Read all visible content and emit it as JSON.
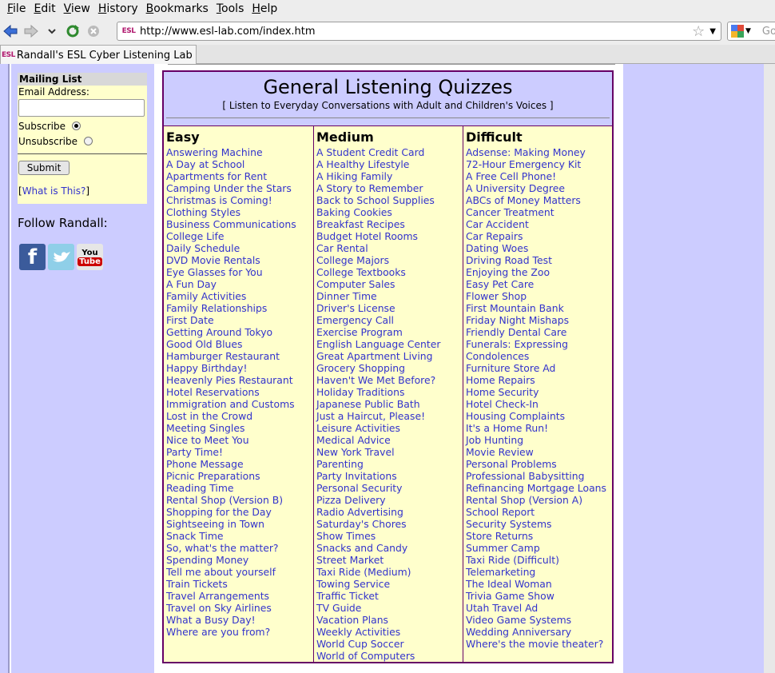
{
  "browser": {
    "menu": [
      "File",
      "Edit",
      "View",
      "History",
      "Bookmarks",
      "Tools",
      "Help"
    ],
    "url": "http://www.esl-lab.com/index.htm",
    "favicon_text": "ESL",
    "search_placeholder": "Go",
    "tab_title": "Randall's ESL Cyber Listening Lab ..."
  },
  "sidebar": {
    "mailing_title": "Mailing List",
    "email_label": "Email Address:",
    "email_value": "",
    "subscribe_label": "Subscribe",
    "unsubscribe_label": "Unsubscribe",
    "selected": "subscribe",
    "submit_label": "Submit",
    "whatis_prefix": "[",
    "whatis_link": "What is This?",
    "whatis_suffix": "]",
    "follow_label": "Follow Randall:",
    "social": [
      "facebook-icon",
      "twitter-icon",
      "youtube-icon"
    ],
    "youtube_text_top": "You",
    "youtube_text_bottom": "Tube"
  },
  "main": {
    "title": "General Listening Quizzes",
    "subtitle": "[ Listen to Everyday Conversations with Adult and Children's Voices ]",
    "columns": [
      {
        "title": "Easy",
        "items": [
          "Answering Machine",
          "A Day at School",
          "Apartments for Rent",
          "Camping Under the Stars",
          "Christmas is Coming!",
          "Clothing Styles",
          "Business Communications",
          "College Life",
          "Daily Schedule",
          "DVD Movie Rentals",
          "Eye Glasses for You",
          "A Fun Day",
          "Family Activities",
          "Family Relationships",
          "First Date",
          "Getting Around Tokyo",
          "Good Old Blues",
          "Hamburger Restaurant",
          "Happy Birthday!",
          "Heavenly Pies Restaurant",
          "Hotel Reservations",
          "Immigration and Customs",
          "Lost in the Crowd",
          "Meeting Singles",
          "Nice to Meet You",
          "Party Time!",
          "Phone Message",
          "Picnic Preparations",
          "Reading Time",
          "Rental Shop (Version B)",
          "Shopping for the Day",
          "Sightseeing in Town",
          "Snack Time",
          "So, what's the matter?",
          "Spending Money",
          "Tell me about yourself",
          "Train Tickets",
          "Travel Arrangements",
          "Travel on Sky Airlines",
          "What a Busy Day!",
          "Where are you from?"
        ]
      },
      {
        "title": "Medium",
        "items": [
          "A Student Credit Card",
          "A Healthy Lifestyle",
          "A Hiking Family",
          "A Story to Remember",
          "Back to School Supplies",
          "Baking Cookies",
          "Breakfast Recipes",
          "Budget Hotel Rooms",
          "Car Rental",
          "College Majors",
          "College Textbooks",
          "Computer Sales",
          "Dinner Time",
          "Driver's License",
          "Emergency Call",
          "Exercise Program",
          "English Language Center",
          "Great Apartment Living",
          "Grocery Shopping",
          "Haven't We Met Before?",
          "Holiday Traditions",
          "Japanese Public Bath",
          "Just a Haircut, Please!",
          "Leisure Activities",
          "Medical Advice",
          "New York Travel",
          "Parenting",
          "Party Invitations",
          "Personal Security",
          "Pizza Delivery",
          "Radio Advertising",
          "Saturday's Chores",
          "Show Times",
          "Snacks and Candy",
          "Street Market",
          "Taxi Ride (Medium)",
          "Towing Service",
          "Traffic Ticket",
          "TV Guide",
          "Vacation Plans",
          "Weekly Activities",
          "World Cup Soccer",
          "World of Computers"
        ]
      },
      {
        "title": "Difficult",
        "items": [
          "Adsense: Making Money",
          "72-Hour Emergency Kit",
          "A Free Cell Phone!",
          "A University Degree",
          "ABCs of Money Matters",
          "Cancer Treatment",
          "Car Accident",
          "Car Repairs",
          "Dating Woes",
          "Driving Road Test",
          "Enjoying the Zoo",
          "Easy Pet Care",
          "Flower Shop",
          "First Mountain Bank",
          "Friday Night Mishaps",
          "Friendly Dental Care",
          "Funerals: Expressing",
          "Condolences",
          "Furniture Store Ad",
          "Home Repairs",
          "Home Security",
          "Hotel Check-In",
          "Housing Complaints",
          "It's a Home Run!",
          "Job Hunting",
          "Movie Review",
          "Personal Problems",
          "Professional Babysitting",
          "Refinancing Mortgage Loans",
          "Rental Shop (Version A)",
          "School Report",
          "Security Systems",
          "Store Returns",
          "Summer Camp",
          "Taxi Ride (Difficult)",
          "Telemarketing",
          "The Ideal Woman",
          "Trivia Game Show",
          "Utah Travel Ad",
          "Video Game Systems",
          "Wedding Anniversary",
          "Where's the movie theater?"
        ]
      }
    ]
  }
}
